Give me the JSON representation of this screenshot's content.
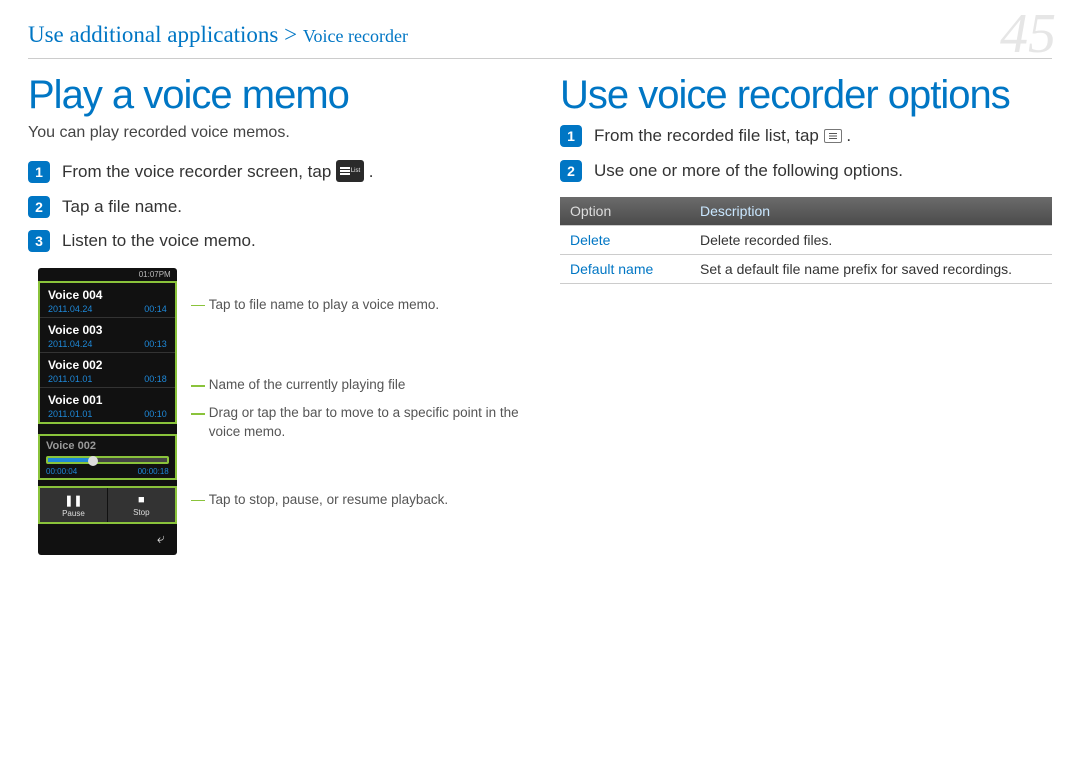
{
  "page_number": "45",
  "breadcrumb": {
    "main": "Use additional applications",
    "sep": " > ",
    "sub": "Voice recorder"
  },
  "left": {
    "heading": "Play a voice memo",
    "intro": "You can play recorded voice memos.",
    "steps": [
      "From the voice recorder screen, tap",
      "Tap a file name.",
      "Listen to the voice memo."
    ],
    "list_icon_label": "List",
    "device": {
      "status": "01:07PM",
      "files": [
        {
          "name": "Voice 004",
          "date": "2011.04.24",
          "dur": "00:14"
        },
        {
          "name": "Voice 003",
          "date": "2011.04.24",
          "dur": "00:13"
        },
        {
          "name": "Voice 002",
          "date": "2011.01.01",
          "dur": "00:18"
        },
        {
          "name": "Voice 001",
          "date": "2011.01.01",
          "dur": "00:10"
        }
      ],
      "nowplaying": {
        "name": "Voice 002",
        "elapsed": "00:00:04",
        "total": "00:00:18"
      },
      "controls": {
        "pause": "Pause",
        "stop": "Stop"
      }
    },
    "callouts": [
      "Tap to file name to play a voice memo.",
      "Name of the currently playing file",
      "Drag or tap the bar to move to a specific point in the voice memo.",
      "Tap to stop, pause, or resume playback."
    ]
  },
  "right": {
    "heading": "Use voice recorder options",
    "steps": [
      "From the recorded file list, tap",
      "Use one or more of the following options."
    ],
    "table": {
      "head_option": "Option",
      "head_desc": "Description",
      "rows": [
        {
          "opt": "Delete",
          "desc": "Delete recorded files."
        },
        {
          "opt": "Default name",
          "desc": "Set a default file name prefix for saved recordings."
        }
      ]
    }
  }
}
